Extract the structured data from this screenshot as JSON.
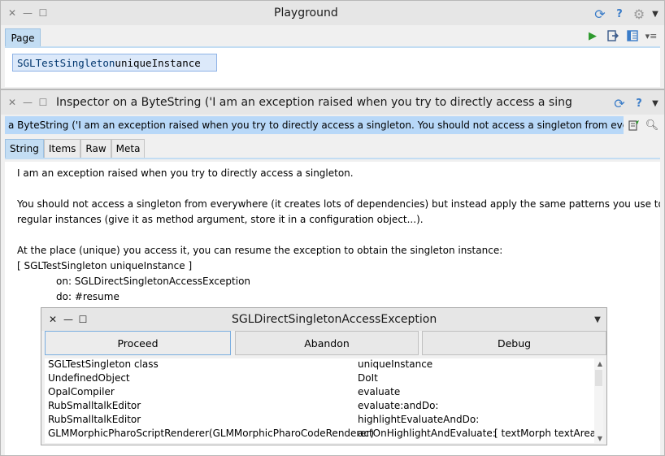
{
  "playground": {
    "title": "Playground",
    "tab": "Page",
    "code_class": "SGLTestSingleton",
    "code_message": " uniqueInstance"
  },
  "inspector": {
    "title": "Inspector on a ByteString ('I am an exception raised when you try to directly access a singleton.  You sh",
    "path": "a ByteString ('I am an exception raised when you try to directly access a singleton.  You should not access a singleton from everywhere (it ...",
    "tabs": [
      "String",
      "Items",
      "Raw",
      "Meta"
    ],
    "lines": [
      "I am an exception raised when you try to directly access a singleton.",
      "",
      "You should not access a singleton from everywhere (it creates lots of dependencies) but instead apply the same patterns you use to access",
      "regular instances (give it as method argument, store it in a configuration object...).",
      "",
      "At the place (unique) you access it, you can resume the exception to obtain the singleton instance:",
      "[ SGLTestSingleton uniqueInstance ]",
      "on: SGLDirectSingletonAccessException",
      "do: #resume"
    ]
  },
  "debugger": {
    "title": "SGLDirectSingletonAccessException",
    "buttons": {
      "proceed": "Proceed",
      "abandon": "Abandon",
      "debug": "Debug"
    },
    "stack": [
      {
        "receiver": "SGLTestSingleton class",
        "selector": "uniqueInstance",
        "extra": ""
      },
      {
        "receiver": "UndefinedObject",
        "selector": "DoIt",
        "extra": ""
      },
      {
        "receiver": "OpalCompiler",
        "selector": "evaluate",
        "extra": ""
      },
      {
        "receiver": "RubSmalltalkEditor",
        "selector": "evaluate:andDo:",
        "extra": ""
      },
      {
        "receiver": "RubSmalltalkEditor",
        "selector": "highlightEvaluateAndDo:",
        "extra": ""
      },
      {
        "receiver": "GLMMorphicPharoScriptRenderer(GLMMorphicPharoCodeRenderer)",
        "selector": "actOnHighlightAndEvaluate:",
        "extra": "[ textMorph textArea ec"
      }
    ]
  },
  "colors": {
    "selection": "#b8d8f8",
    "tab_active": "#c3ddf3",
    "icon_blue": "#3a7cc8",
    "run_green": "#2e9a2e"
  }
}
